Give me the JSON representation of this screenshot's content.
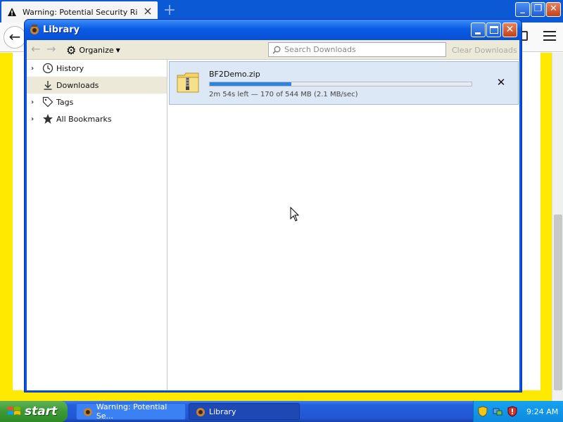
{
  "browser": {
    "tab_title": "Warning: Potential Security Risk Ahead",
    "new_tab_label": "+"
  },
  "library": {
    "title": "Library",
    "toolbar": {
      "organize_label": "Organize",
      "search_placeholder": "Search Downloads",
      "clear_downloads_label": "Clear Downloads"
    },
    "sidebar": {
      "items": [
        {
          "label": "History",
          "icon": "clock-icon",
          "expandable": true,
          "selected": false
        },
        {
          "label": "Downloads",
          "icon": "download-arrow-icon",
          "expandable": false,
          "selected": true
        },
        {
          "label": "Tags",
          "icon": "tag-icon",
          "expandable": true,
          "selected": false
        },
        {
          "label": "All Bookmarks",
          "icon": "star-icon",
          "expandable": true,
          "selected": false
        }
      ]
    },
    "downloads": [
      {
        "filename": "BF2Demo.zip",
        "status": "2m 54s left — 170 of 544 MB (2.1 MB/sec)",
        "progress": 0.312,
        "icon": "zip-file-icon"
      }
    ]
  },
  "taskbar": {
    "start_label": "start",
    "tasks": [
      {
        "label": "Warning: Potential Se...",
        "active": false
      },
      {
        "label": "Library",
        "active": true
      }
    ],
    "clock": "9:24 AM"
  },
  "colors": {
    "xp_blue": "#0a55e0",
    "warning_yellow": "#ffe900",
    "progress_blue": "#2f83e0",
    "start_green": "#3c9a34"
  }
}
